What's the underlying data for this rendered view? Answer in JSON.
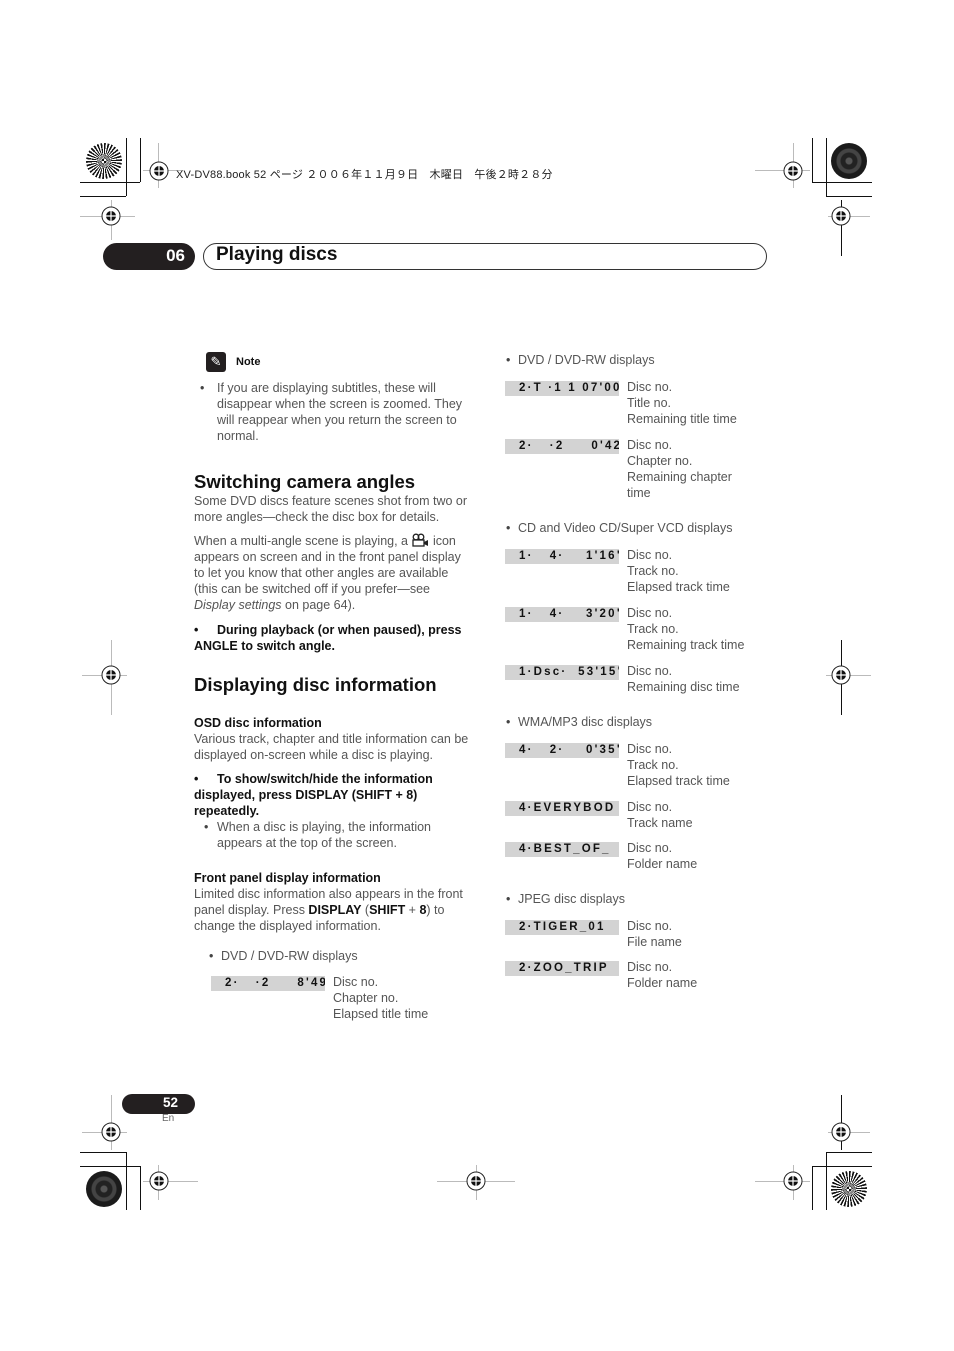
{
  "header": {
    "meta_line": "XV-DV88.book  52 ページ  ２００６年１１月９日　木曜日　午後２時２８分",
    "chapter_number": "06",
    "chapter_title": "Playing discs"
  },
  "note": {
    "icon": "pencil-icon",
    "label": "Note",
    "items": [
      "If you are displaying subtitles, these will disappear when the screen is zoomed. They will reappear when you return the screen to normal."
    ]
  },
  "camera_angles": {
    "heading": "Switching camera angles",
    "para1": "Some DVD discs feature scenes shot from two or more angles—check the disc box for details.",
    "para2_before_icon": "When a multi-angle scene is playing, a ",
    "para2_icon": "camera-angle-icon",
    "para2_after_icon": " icon appears on screen and in the front panel display to let you know that other angles are available (this can be switched off if you prefer—see ",
    "para2_link": "Display settings",
    "para2_end": " on page 64).",
    "step_bullet": "•",
    "step": "During playback (or when paused), press ANGLE to switch angle."
  },
  "disc_info": {
    "heading": "Displaying disc information",
    "osd": {
      "heading": "OSD disc information",
      "para": "Various track, chapter and title information can be displayed on-screen while a disc is playing.",
      "step_bullet": "•",
      "step": "To show/switch/hide the information displayed, press DISPLAY (SHIFT + 8) repeatedly.",
      "sub_items": [
        "When a disc is playing, the information appears at the top of the screen."
      ]
    },
    "front_panel": {
      "heading": "Front panel display information",
      "para_1": "Limited disc information also appears in the front panel display. Press ",
      "para_key1": "DISPLAY",
      "para_2": " (",
      "para_key2": "SHIFT",
      "para_3": " + ",
      "para_key3": "8",
      "para_4": ") to change the displayed information."
    }
  },
  "display_groups": [
    {
      "title": "DVD / DVD-RW displays",
      "rows": [
        {
          "lcd": "2·   ·2     8'49\"",
          "desc": [
            "Disc no.",
            "Chapter no.",
            "Elapsed title time"
          ]
        }
      ]
    },
    {
      "title": "DVD / DVD-RW displays",
      "rows": [
        {
          "lcd": "2·T ·1 1 07'00\"",
          "desc": [
            "Disc no.",
            "Title no.",
            "Remaining title time"
          ]
        },
        {
          "lcd": "2·   ·2     0'42\"",
          "desc": [
            "Disc no.",
            "Chapter no.",
            "Remaining chapter time"
          ]
        }
      ]
    },
    {
      "title": "CD and Video CD/Super VCD displays",
      "rows": [
        {
          "lcd": "1·   4·    1'16\"",
          "desc": [
            "Disc no.",
            "Track no.",
            "Elapsed track time"
          ]
        },
        {
          "lcd": "1·   4·    3'20\"",
          "desc": [
            "Disc no.",
            "Track no.",
            "Remaining track time"
          ]
        },
        {
          "lcd": "1·Dsc·  53'15\"",
          "desc": [
            "Disc no.",
            "Remaining disc time"
          ]
        }
      ]
    },
    {
      "title": "WMA/MP3 disc displays",
      "rows": [
        {
          "lcd": "4·   2·    0'35\"",
          "desc": [
            "Disc no.",
            "Track no.",
            "Elapsed track time"
          ]
        },
        {
          "lcd": "4·EVERYBOD",
          "desc": [
            "Disc no.",
            "Track name"
          ]
        },
        {
          "lcd": "4·BEST_OF_",
          "desc": [
            "Disc no.",
            "Folder name"
          ]
        }
      ]
    },
    {
      "title": "JPEG disc displays",
      "rows": [
        {
          "lcd": "2·TIGER_01",
          "desc": [
            "Disc no.",
            "File name"
          ]
        },
        {
          "lcd": "2·ZOO_TRIP",
          "desc": [
            "Disc no.",
            "Folder name"
          ]
        }
      ]
    }
  ],
  "footer": {
    "page_number": "52",
    "language": "En"
  }
}
